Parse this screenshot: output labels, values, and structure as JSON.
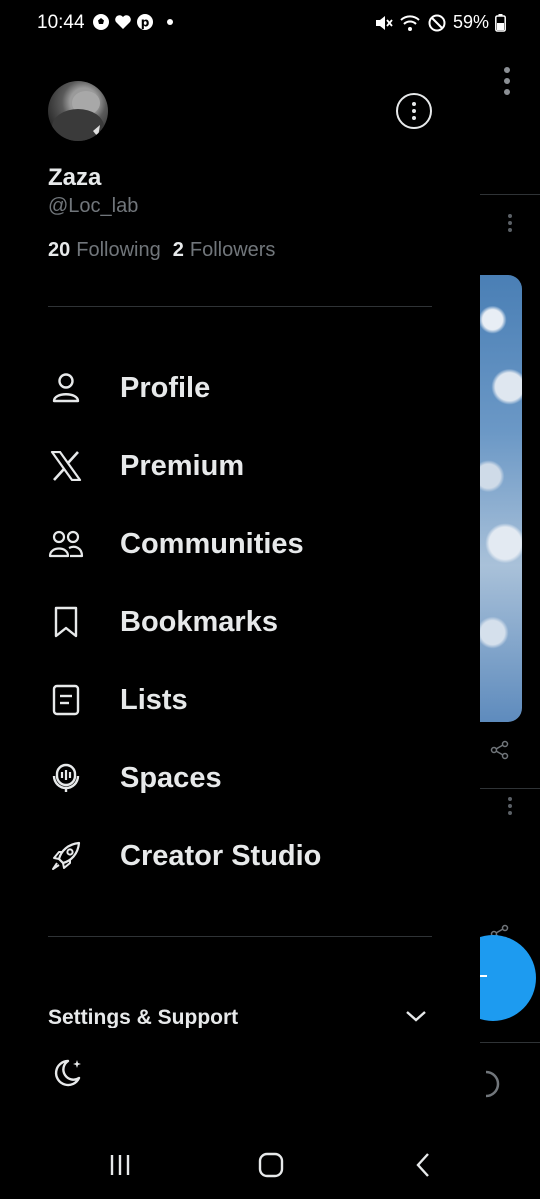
{
  "status_bar": {
    "time": "10:44",
    "notification_icons": [
      "soccer-ball-icon",
      "heart-icon",
      "pinterest-icon",
      "dot-icon"
    ],
    "system_icons": [
      "mute-icon",
      "wifi-icon",
      "do-not-disturb-icon"
    ],
    "battery": "59%"
  },
  "profile": {
    "display_name": "Zaza",
    "handle": "@Loc_lab",
    "following_count": "20",
    "following_label": "Following",
    "followers_count": "2",
    "followers_label": "Followers"
  },
  "menu": {
    "items": [
      {
        "label": "Profile",
        "icon": "person-icon"
      },
      {
        "label": "Premium",
        "icon": "x-logo-icon"
      },
      {
        "label": "Communities",
        "icon": "communities-icon"
      },
      {
        "label": "Bookmarks",
        "icon": "bookmark-icon"
      },
      {
        "label": "Lists",
        "icon": "list-icon"
      },
      {
        "label": "Spaces",
        "icon": "spaces-icon"
      },
      {
        "label": "Creator Studio",
        "icon": "rocket-icon"
      }
    ]
  },
  "settings": {
    "label": "Settings & Support",
    "state": "collapsed"
  },
  "theme": {
    "icon": "moon-sparkle-icon"
  },
  "colors": {
    "background": "#000000",
    "text_primary": "#e7e9ea",
    "text_secondary": "#71767b",
    "divider": "#2f3336",
    "accent": "#1d9bf0"
  },
  "nav_bar": {
    "buttons": [
      "recent-apps-icon",
      "home-icon",
      "back-icon"
    ]
  }
}
